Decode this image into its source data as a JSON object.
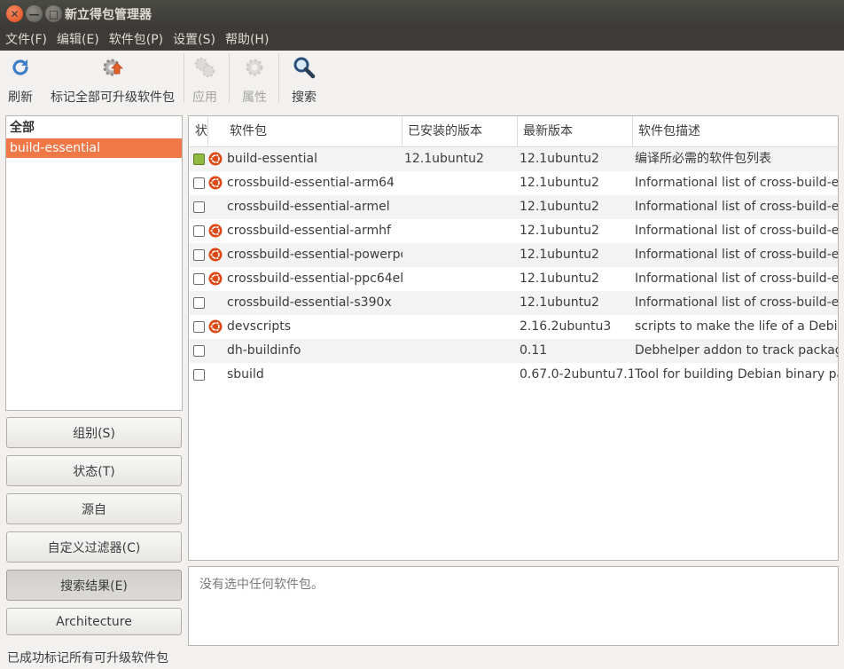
{
  "window": {
    "title": "新立得包管理器",
    "close_glyph": "✕",
    "minimize_glyph": "—",
    "maximize_glyph": "□"
  },
  "menu": [
    "文件(F)",
    "编辑(E)",
    "软件包(P)",
    "设置(S)",
    "帮助(H)"
  ],
  "toolbar": {
    "refresh": {
      "label": "刷新",
      "icon": "refresh-icon"
    },
    "mark_upgrades": {
      "label": "标记全部可升级软件包",
      "icon": "gear-upgrade-icon"
    },
    "apply": {
      "label": "应用",
      "icon": "gears-apply-icon"
    },
    "properties": {
      "label": "属性",
      "icon": "gear-properties-icon"
    },
    "search": {
      "label": "搜索",
      "icon": "magnifier-icon"
    }
  },
  "filter_list": {
    "header": "全部",
    "items": [
      {
        "label": "build-essential",
        "selected": true
      }
    ]
  },
  "side_buttons": [
    "组别(S)",
    "状态(T)",
    "源自",
    "自定义过滤器(C)",
    "搜索结果(E)",
    "Architecture"
  ],
  "active_side_button": "搜索结果(E)",
  "table": {
    "columns": [
      "状",
      "软件包",
      "已安装的版本",
      "最新版本",
      "软件包描述"
    ],
    "rows": [
      {
        "installed": true,
        "ubuntu": true,
        "name": "build-essential",
        "installed_version": "12.1ubuntu2",
        "latest_version": "12.1ubuntu2",
        "description": "编译所必需的软件包列表"
      },
      {
        "installed": false,
        "ubuntu": true,
        "name": "crossbuild-essential-arm64",
        "installed_version": "",
        "latest_version": "12.1ubuntu2",
        "description": "Informational list of cross-build-es"
      },
      {
        "installed": false,
        "ubuntu": false,
        "name": "crossbuild-essential-armel",
        "installed_version": "",
        "latest_version": "12.1ubuntu2",
        "description": "Informational list of cross-build-es"
      },
      {
        "installed": false,
        "ubuntu": true,
        "name": "crossbuild-essential-armhf",
        "installed_version": "",
        "latest_version": "12.1ubuntu2",
        "description": "Informational list of cross-build-es"
      },
      {
        "installed": false,
        "ubuntu": true,
        "name": "crossbuild-essential-powerpc",
        "installed_version": "",
        "latest_version": "12.1ubuntu2",
        "description": "Informational list of cross-build-es"
      },
      {
        "installed": false,
        "ubuntu": true,
        "name": "crossbuild-essential-ppc64el",
        "installed_version": "",
        "latest_version": "12.1ubuntu2",
        "description": "Informational list of cross-build-es"
      },
      {
        "installed": false,
        "ubuntu": false,
        "name": "crossbuild-essential-s390x",
        "installed_version": "",
        "latest_version": "12.1ubuntu2",
        "description": "Informational list of cross-build-es"
      },
      {
        "installed": false,
        "ubuntu": true,
        "name": "devscripts",
        "installed_version": "",
        "latest_version": "2.16.2ubuntu3",
        "description": "scripts to make the life of a Debian"
      },
      {
        "installed": false,
        "ubuntu": false,
        "name": "dh-buildinfo",
        "installed_version": "",
        "latest_version": "0.11",
        "description": "Debhelper addon to track package"
      },
      {
        "installed": false,
        "ubuntu": false,
        "name": "sbuild",
        "installed_version": "",
        "latest_version": "0.67.0-2ubuntu7.1",
        "description": "Tool for building Debian binary pa"
      }
    ]
  },
  "details": {
    "placeholder": "没有选中任何软件包。"
  },
  "status": "已成功标记所有可升级软件包",
  "colors": {
    "accent": "#f07746",
    "installed": "#8fb941",
    "ubuntu_logo": "#dd4814",
    "titlebar": "#3c3b37"
  }
}
